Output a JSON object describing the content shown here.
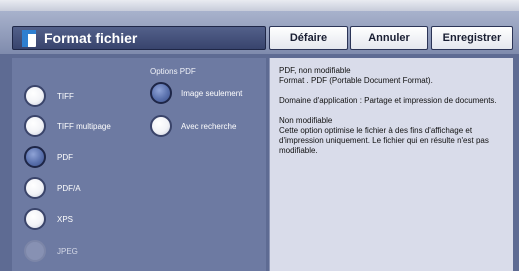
{
  "header": {
    "title": "Format fichier",
    "title_icon": "document-icon",
    "buttons": {
      "undo": "Défaire",
      "cancel": "Annuler",
      "save": "Enregistrer"
    }
  },
  "formats": [
    {
      "label": "TIFF",
      "selected": false,
      "enabled": true
    },
    {
      "label": "TIFF multipage",
      "selected": false,
      "enabled": true
    },
    {
      "label": "PDF",
      "selected": true,
      "enabled": true
    },
    {
      "label": "PDF/A",
      "selected": false,
      "enabled": true
    },
    {
      "label": "XPS",
      "selected": false,
      "enabled": true
    },
    {
      "label": "JPEG",
      "selected": false,
      "enabled": false
    }
  ],
  "pdf_options": {
    "title": "Options PDF",
    "items": [
      {
        "label": "Image seulement",
        "selected": true
      },
      {
        "label": "Avec recherche",
        "selected": false
      }
    ]
  },
  "description": {
    "line1": "PDF, non modifiable",
    "line2": "Format . PDF (Portable Document Format).",
    "line3": "Domaine d'application : Partage et impression de documents.",
    "line4": "Non modifiable",
    "line5": "Cette option optimise le fichier à des fins d'affichage et d'impression uniquement. Le fichier qui en résulte n'est pas modifiable."
  },
  "colors": {
    "accent": "#2f7fd0",
    "panel": "#6d7aa2",
    "selected_radio": "#5a71ad"
  }
}
